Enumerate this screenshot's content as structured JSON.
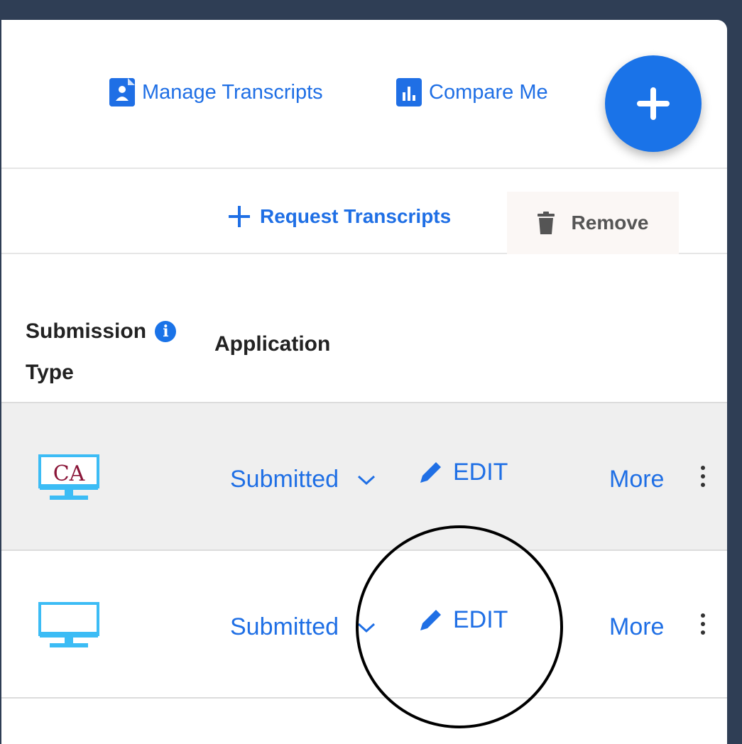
{
  "header": {
    "manage_transcripts": "Manage Transcripts",
    "compare_me": "Compare Me",
    "add_button_icon": "plus-icon"
  },
  "toolbar": {
    "request_transcripts": "Request Transcripts",
    "remove": "Remove"
  },
  "table": {
    "columns": {
      "submission_type": "Submission",
      "submission_type_line2": "Type",
      "application": "Application"
    },
    "rows": [
      {
        "icon_text": "CA",
        "status": "Submitted",
        "edit": "EDIT",
        "more": "More"
      },
      {
        "icon_text": "",
        "status": "Submitted",
        "edit": "EDIT",
        "more": "More"
      }
    ]
  },
  "colors": {
    "accent": "#1a73e8",
    "link": "#1f6fe5",
    "monitor": "#3cbcf5",
    "ca_text": "#8a1538",
    "background": "#2f3e55"
  }
}
